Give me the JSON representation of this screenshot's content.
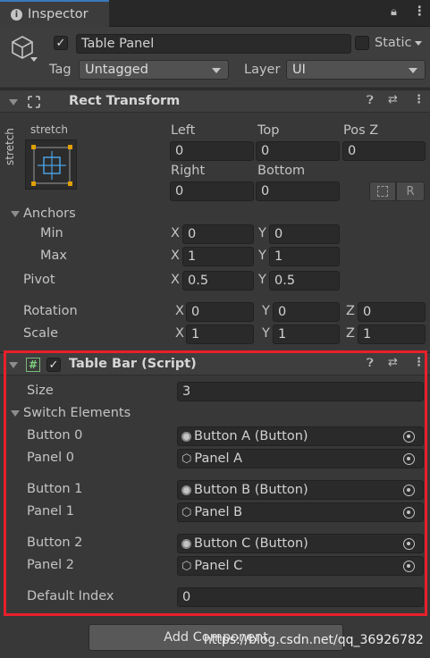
{
  "tab": {
    "title": "Inspector"
  },
  "header": {
    "object_name": "Table Panel",
    "static_label": "Static",
    "tag_label": "Tag",
    "tag_value": "Untagged",
    "layer_label": "Layer",
    "layer_value": "UI"
  },
  "rect_transform": {
    "title": "Rect Transform",
    "anchor_preset_top": "stretch",
    "anchor_preset_side": "stretch",
    "left_label": "Left",
    "left_value": "0",
    "top_label": "Top",
    "top_value": "0",
    "posz_label": "Pos Z",
    "posz_value": "0",
    "right_label": "Right",
    "right_value": "0",
    "bottom_label": "Bottom",
    "bottom_value": "0",
    "raw_button": "R",
    "anchors_label": "Anchors",
    "min_label": "Min",
    "min_x": "0",
    "min_y": "0",
    "max_label": "Max",
    "max_x": "1",
    "max_y": "1",
    "pivot_label": "Pivot",
    "pivot_x": "0.5",
    "pivot_y": "0.5",
    "rotation_label": "Rotation",
    "rot_x": "0",
    "rot_y": "0",
    "rot_z": "0",
    "scale_label": "Scale",
    "scale_x": "1",
    "scale_y": "1",
    "scale_z": "1",
    "axis_x": "X",
    "axis_y": "Y",
    "axis_z": "Z"
  },
  "table_bar": {
    "title": "Table Bar (Script)",
    "size_label": "Size",
    "size_value": "3",
    "switch_label": "Switch Elements",
    "button0_label": "Button 0",
    "button0_value": "Button A (Button)",
    "panel0_label": "Panel 0",
    "panel0_value": "Panel A",
    "button1_label": "Button 1",
    "button1_value": "Button B (Button)",
    "panel1_label": "Panel 1",
    "panel1_value": "Panel B",
    "button2_label": "Button 2",
    "button2_value": "Button C (Button)",
    "panel2_label": "Panel 2",
    "panel2_value": "Panel C",
    "default_index_label": "Default Index",
    "default_index_value": "0"
  },
  "add_component": "Add Component",
  "watermark": "https://blog.csdn.net/qq_36926782",
  "colors": {
    "highlight": "#e8202a",
    "tab_accent": "#3a79bb",
    "background": "#383838"
  }
}
